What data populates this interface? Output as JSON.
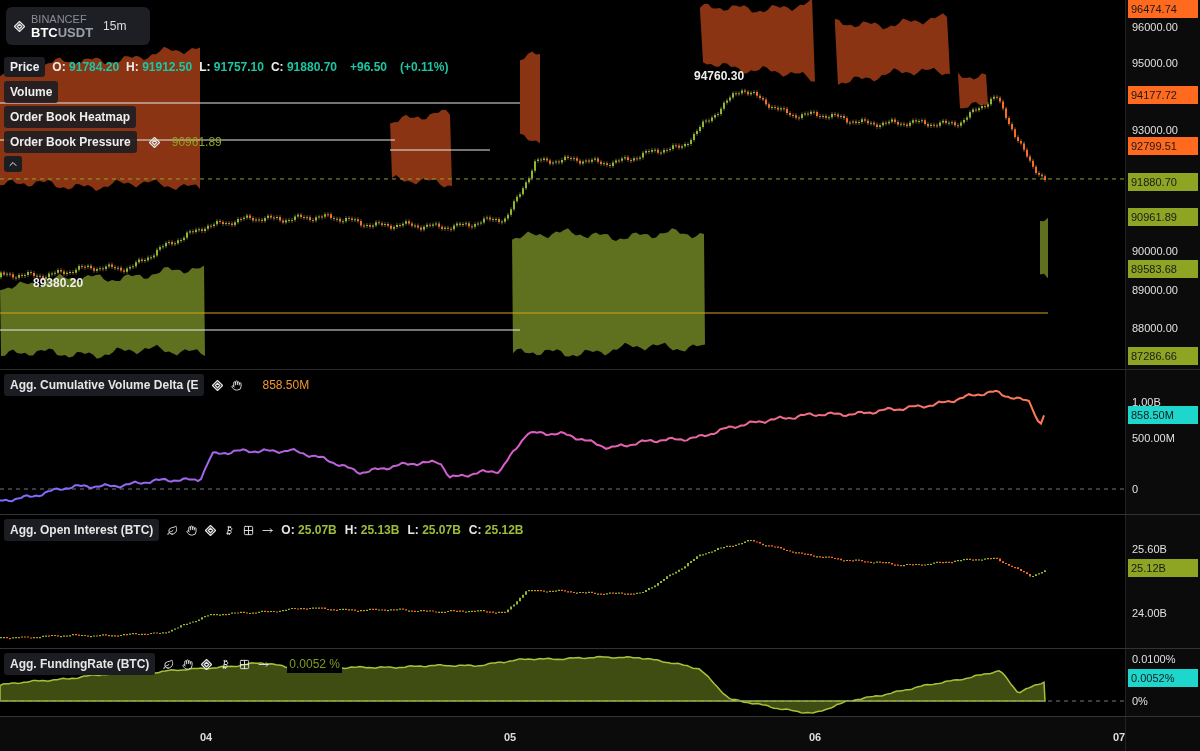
{
  "symbol": {
    "exchange": "BINANCEF",
    "base": "BTC",
    "quote": "USDT",
    "interval": "15m"
  },
  "price_legend": {
    "label": "Price",
    "fields": [
      {
        "key": "O:",
        "value": "91784.20"
      },
      {
        "key": "H:",
        "value": "91912.50"
      },
      {
        "key": "L:",
        "value": "91757.10"
      },
      {
        "key": "C:",
        "value": "91880.70"
      }
    ],
    "change": "+96.50",
    "change_pct": "(+0.11%)"
  },
  "overlays": [
    {
      "label": "Volume"
    },
    {
      "label": "Order Book Heatmap"
    },
    {
      "label": "Order Book Pressure",
      "value": "90961.89"
    }
  ],
  "chart_labels": [
    {
      "text": "94760.30"
    },
    {
      "text": "89380.20"
    }
  ],
  "price_axis": {
    "ticks": [
      "96000.00",
      "95000.00",
      "93000.00",
      "90000.00",
      "89000.00",
      "88000.00"
    ],
    "tags": [
      {
        "text": "96474.74",
        "color": "#ff6a1f"
      },
      {
        "text": "94177.72",
        "color": "#ff6a1f"
      },
      {
        "text": "92799.51",
        "color": "#ff6a1f"
      },
      {
        "text": "91880.70",
        "color": "#8ea523"
      },
      {
        "text": "90961.89",
        "color": "#8ea523"
      },
      {
        "text": "89583.68",
        "color": "#8ea523"
      },
      {
        "text": "87286.66",
        "color": "#8ea523"
      }
    ]
  },
  "panels": [
    {
      "kind": "value",
      "title": "Agg. Cumulative Volume Delta (E",
      "value": "858.50M",
      "ticks": [
        "1.00B",
        "500.00M",
        "0"
      ],
      "tag": {
        "text": "858.50M",
        "color": "#1dd6cc"
      }
    },
    {
      "kind": "ohlc",
      "title": "Agg. Open Interest (BTC)",
      "fields": [
        {
          "key": "O:",
          "value": "25.07B"
        },
        {
          "key": "H:",
          "value": "25.13B"
        },
        {
          "key": "L:",
          "value": "25.07B"
        },
        {
          "key": "C:",
          "value": "25.12B"
        }
      ],
      "ticks": [
        "25.60B",
        "24.00B"
      ],
      "tag": {
        "text": "25.12B",
        "color": "#8ea523"
      }
    },
    {
      "kind": "value",
      "title": "Agg. FundingRate (BTC)",
      "value": "0.0052 %",
      "ticks": [
        "0.0100%",
        "0%"
      ],
      "tag": {
        "text": "0.0052%",
        "color": "#1dd6cc"
      }
    }
  ],
  "time_axis": [
    "04",
    "05",
    "06",
    "07"
  ]
}
